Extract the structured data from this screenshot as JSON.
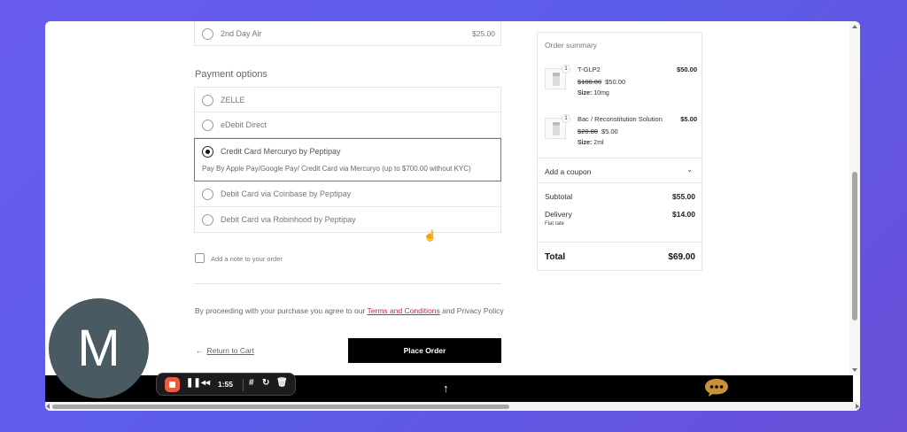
{
  "shipping": {
    "option_label": "2nd Day Air",
    "option_price": "$25.00"
  },
  "payment": {
    "section_title": "Payment options",
    "options": [
      {
        "label": "ZELLE"
      },
      {
        "label": "eDebit Direct"
      },
      {
        "label": "Credit Card Mercuryo by Peptipay",
        "description": "Pay By Apple Pay/Google Pay/ Credit Card via Mercuryo (up to $700.00 without KYC)"
      },
      {
        "label": "Debit Card via Coinbase by Peptipay"
      },
      {
        "label": "Debit Card via Robinhood by Peptipay"
      }
    ],
    "selected_index": 2
  },
  "note": {
    "label": "Add a note to your order"
  },
  "terms": {
    "prefix": "By proceeding with your purchase you agree to our",
    "terms_link": "Terms and Conditions",
    "connector": "and",
    "privacy": "Privacy Policy"
  },
  "actions": {
    "return_label": "Return to Cart",
    "place_order_label": "Place Order"
  },
  "summary": {
    "title": "Order summary",
    "items": [
      {
        "qty": "1",
        "name": "T-GLP2",
        "amount": "$50.00",
        "old_price": "$100.00",
        "price": "$50.00",
        "size_label": "Size:",
        "size_value": "10mg"
      },
      {
        "qty": "1",
        "name": "Bac / Reconstitution Solution",
        "amount": "$5.00",
        "old_price": "$20.00",
        "price": "$5.00",
        "size_label": "Size:",
        "size_value": "2ml"
      }
    ],
    "coupon_label": "Add a coupon",
    "subtotal_label": "Subtotal",
    "subtotal_value": "$55.00",
    "delivery_label": "Delivery",
    "delivery_value": "$14.00",
    "delivery_note": "Flat rate",
    "total_label": "Total",
    "total_value": "$69.00"
  },
  "recorder": {
    "avatar_letter": "M",
    "time": "1:55"
  },
  "colors": {
    "link": "#c0284a",
    "record": "#ea5a44",
    "chat": "#c8923a"
  }
}
